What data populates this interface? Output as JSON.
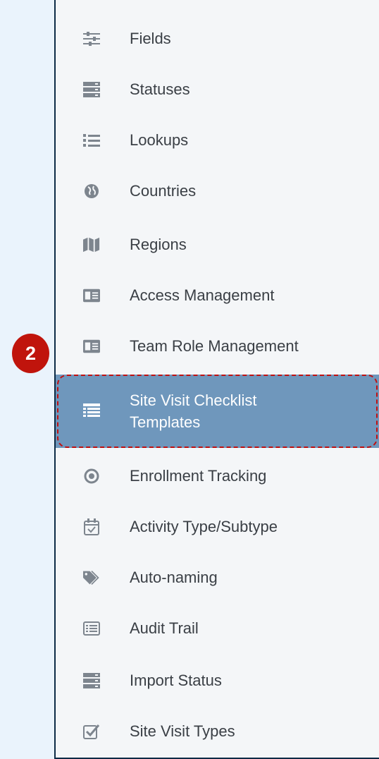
{
  "step_badge": "2",
  "colors": {
    "active_bg": "#6f97bc",
    "highlight_border": "#c01010",
    "badge_bg": "#c0140c",
    "icon_color": "#7d858e"
  },
  "menu": [
    {
      "label": "Fields",
      "icon": "sliders-icon"
    },
    {
      "label": "Statuses",
      "icon": "server-icon"
    },
    {
      "label": "Lookups",
      "icon": "list-icon"
    },
    {
      "label": "Countries",
      "icon": "globe-icon"
    },
    {
      "label": "Regions",
      "icon": "map-icon"
    },
    {
      "label": "Access Management",
      "icon": "id-card-icon"
    },
    {
      "label": "Team Role Management",
      "icon": "id-card-icon"
    },
    {
      "label": "Site Visit Checklist Templates",
      "line1": "Site Visit Checklist",
      "line2": "Templates",
      "icon": "list-alt-icon",
      "active": true
    },
    {
      "label": "Enrollment Tracking",
      "icon": "compass-icon"
    },
    {
      "label": "Activity Type/Subtype",
      "icon": "calendar-check-icon"
    },
    {
      "label": "Auto-naming",
      "icon": "tags-icon"
    },
    {
      "label": "Audit Trail",
      "icon": "list-box-icon"
    },
    {
      "label": "Import Status",
      "icon": "server-icon"
    },
    {
      "label": "Site Visit Types",
      "icon": "check-square-icon"
    }
  ]
}
